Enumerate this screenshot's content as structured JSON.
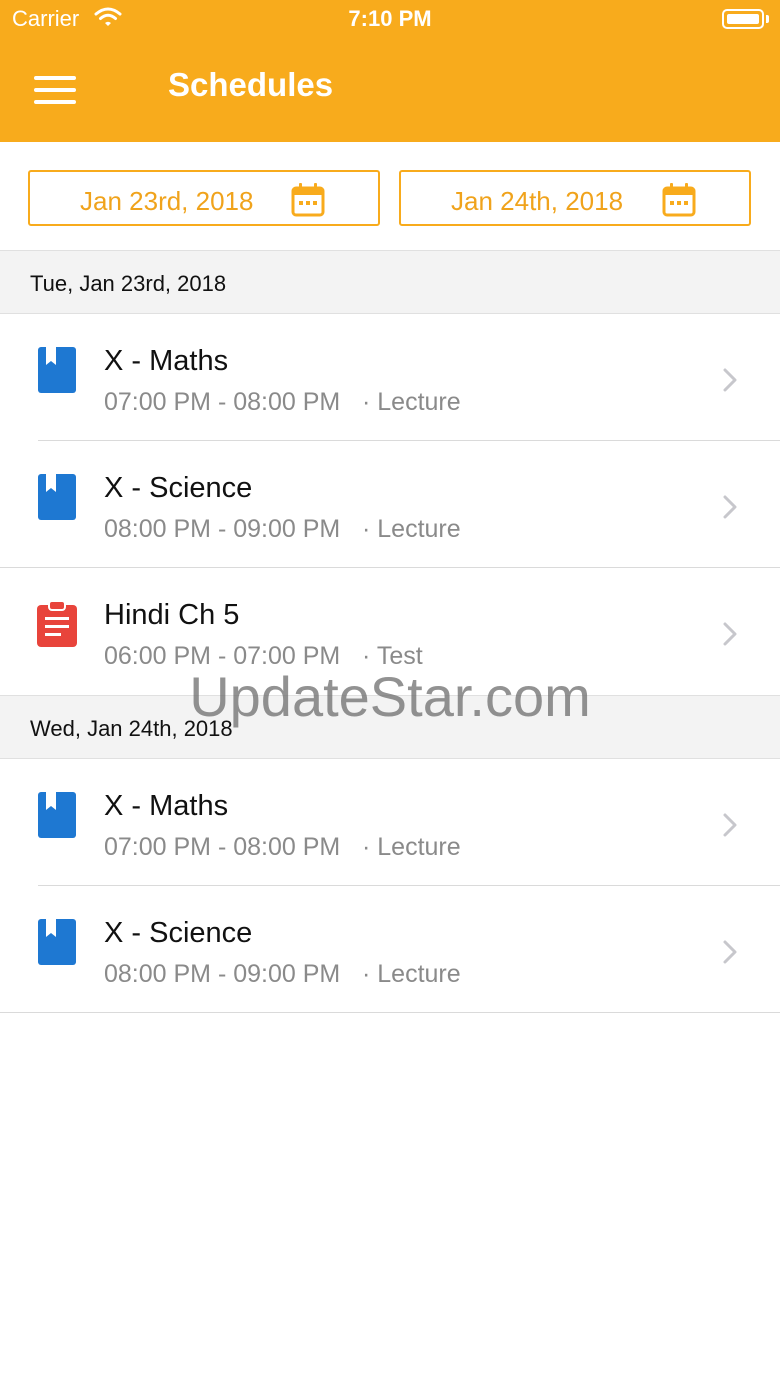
{
  "status": {
    "carrier": "Carrier",
    "time": "7:10 PM"
  },
  "header": {
    "title": "Schedules"
  },
  "filters": {
    "from_date": "Jan 23rd, 2018",
    "to_date": "Jan 24th, 2018"
  },
  "colors": {
    "accent": "#f8ab1c",
    "lecture_icon": "#1e78d2",
    "test_icon": "#e8443b"
  },
  "sections": [
    {
      "date": "Tue, Jan 23rd, 2018",
      "items": [
        {
          "title": "X - Maths",
          "time": "07:00 PM - 08:00 PM",
          "type": "· Lecture",
          "icon": "book-icon"
        },
        {
          "title": "X - Science",
          "time": "08:00 PM - 09:00 PM",
          "type": "· Lecture",
          "icon": "book-icon"
        },
        {
          "title": "Hindi Ch 5",
          "time": "06:00 PM - 07:00 PM",
          "type": "· Test",
          "icon": "clipboard-icon"
        }
      ]
    },
    {
      "date": "Wed, Jan 24th, 2018",
      "items": [
        {
          "title": "X - Maths",
          "time": "07:00 PM - 08:00 PM",
          "type": "· Lecture",
          "icon": "book-icon"
        },
        {
          "title": "X - Science",
          "time": "08:00 PM - 09:00 PM",
          "type": "· Lecture",
          "icon": "book-icon"
        }
      ]
    }
  ],
  "watermark": "UpdateStar.com"
}
